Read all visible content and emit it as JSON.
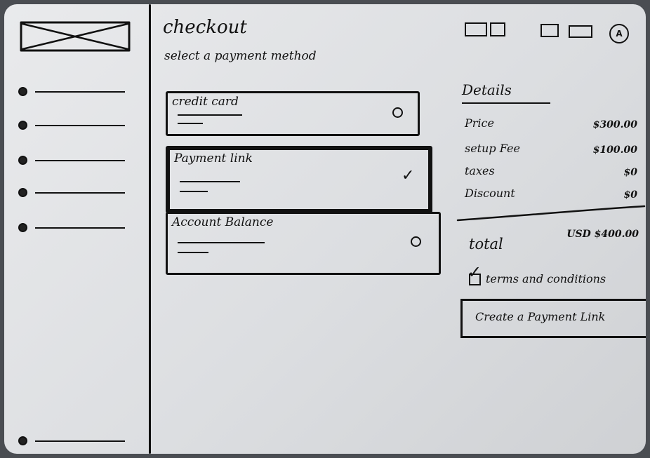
{
  "header": {
    "title": "checkout",
    "subtitle": "select a payment method"
  },
  "toolbar": {
    "icons": [
      "flag-icon",
      "flag-icon",
      "window-icon",
      "window-icon"
    ],
    "avatar_initial": "A"
  },
  "sidebar": {
    "item_count": 6
  },
  "payment_options": [
    {
      "label": "credit card",
      "selected": false
    },
    {
      "label": "Payment link",
      "selected": true
    },
    {
      "label": "Account Balance",
      "selected": false
    }
  ],
  "details": {
    "title": "Details",
    "rows": [
      {
        "label": "Price",
        "value": "$300.00"
      },
      {
        "label": "setup Fee",
        "value": "$100.00"
      },
      {
        "label": "taxes",
        "value": "$0"
      },
      {
        "label": "Discount",
        "value": "$0"
      }
    ],
    "total_label": "total",
    "total_value": "USD $400.00"
  },
  "terms": {
    "label": "terms and conditions",
    "checked": true
  },
  "cta": {
    "label": "Create a Payment Link"
  }
}
